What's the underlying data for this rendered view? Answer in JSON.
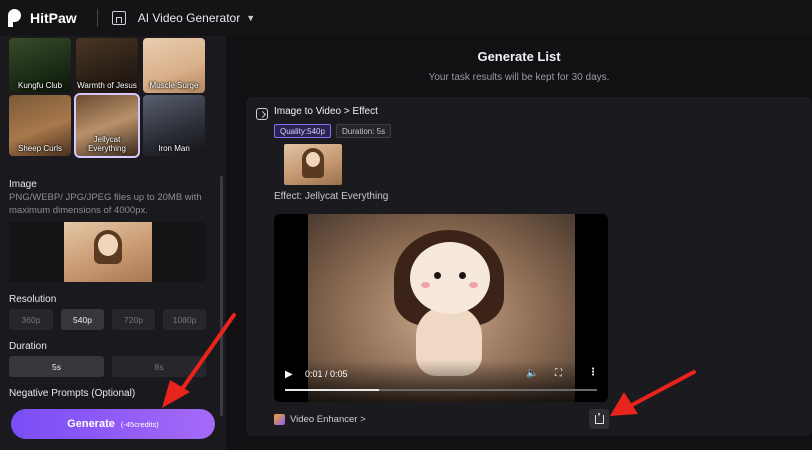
{
  "topbar": {
    "brand": "HitPaw",
    "tool": "AI Video Generator"
  },
  "sidebar": {
    "templates": [
      {
        "label": "Kungfu Club"
      },
      {
        "label": "Warmth of Jesus"
      },
      {
        "label": "Muscle Surge"
      },
      {
        "label": "Sheep Curls"
      },
      {
        "label": "Jellycat Everything",
        "selected": true
      },
      {
        "label": "Iron Man"
      }
    ],
    "image": {
      "title": "Image",
      "desc": "PNG/WEBP/ JPG/JPEG files up to 20MB with maximum dimensions of 4000px."
    },
    "resolution": {
      "title": "Resolution",
      "options": [
        "360p",
        "540p",
        "720p",
        "1080p"
      ],
      "selected": "540p"
    },
    "duration": {
      "title": "Duration",
      "options": [
        "5s",
        "8s"
      ],
      "selected": "5s"
    },
    "negative_prompts": "Negative Prompts (Optional)",
    "generate": {
      "label": "Generate",
      "credits": "(-45credits)"
    }
  },
  "main": {
    "title": "Generate List",
    "subtitle": "Your task results will be kept for 30 days.",
    "task": {
      "breadcrumb": "Image to Video > Effect",
      "quality": "Quality:540p",
      "duration": "Duration: 5s",
      "effect": "Effect: Jellycat Everything",
      "player": {
        "time": "0:01 / 0:05",
        "progress": 0.3
      },
      "enhancer": "Video Enhancer >"
    }
  },
  "colors": {
    "accent": "#8b5cf6",
    "annotation_arrow": "#e8241c"
  }
}
